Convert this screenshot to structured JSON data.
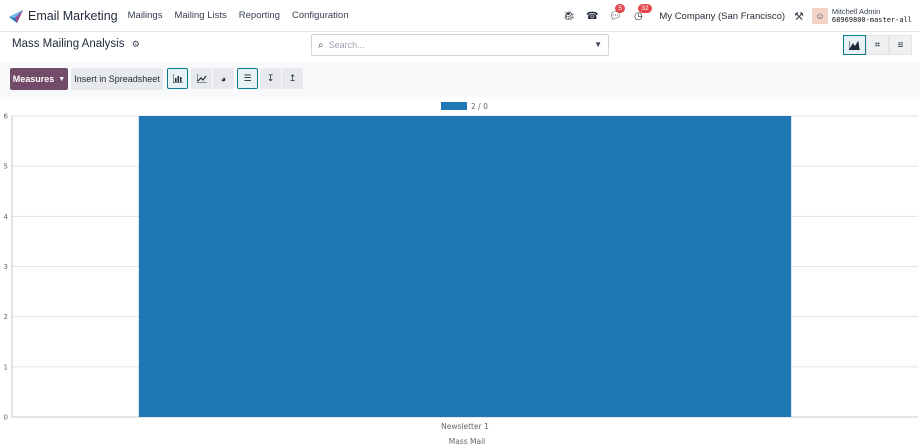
{
  "navbar": {
    "app_name": "Email Marketing",
    "menu": [
      "Mailings",
      "Mailing Lists",
      "Reporting",
      "Configuration"
    ],
    "messages_badge": "5",
    "activities_badge": "32",
    "company": "My Company (San Francisco)",
    "user_name": "Mitchell Admin",
    "database": "68969800-master-all"
  },
  "control": {
    "page_title": "Mass Mailing Analysis",
    "search_placeholder": "Search..."
  },
  "toolbar": {
    "measures_label": "Measures",
    "spreadsheet_label": "Insert in Spreadsheet"
  },
  "colors": {
    "brand_primary": "#714b67",
    "active_accent": "#0d7c8a",
    "bar": "#1f77b4",
    "badge": "#e5484d"
  },
  "icons": {
    "view_switcher": [
      "graph-view-icon",
      "pivot-view-icon",
      "list-view-icon"
    ],
    "chart_types": [
      "bar-chart-icon",
      "line-chart-icon",
      "pie-chart-icon",
      "stacked-icon",
      "descending-icon",
      "ascending-icon"
    ]
  },
  "chart_data": {
    "type": "bar",
    "categories": [
      "Newsletter 1"
    ],
    "series": [
      {
        "name": "2 / 0",
        "values": [
          6
        ]
      }
    ],
    "xlabel": "Mass Mail",
    "ylabel": "",
    "ylim": [
      0,
      6
    ],
    "yticks": [
      0,
      1,
      2,
      3,
      4,
      5,
      6
    ],
    "legend": "top-center",
    "grid": true
  }
}
